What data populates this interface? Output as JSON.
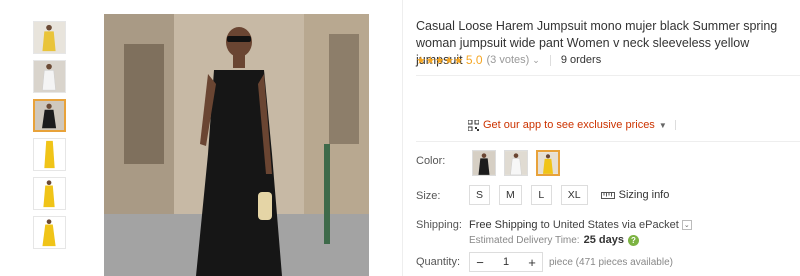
{
  "thumbnails": [
    {
      "name": "thumb-1",
      "color": "#e9c43a"
    },
    {
      "name": "thumb-2",
      "color": "#f1f1f1"
    },
    {
      "name": "thumb-3",
      "color": "#1c1c1c",
      "selected": true
    },
    {
      "name": "thumb-4",
      "color": "#f0c418"
    },
    {
      "name": "thumb-5",
      "color": "#f0c418"
    },
    {
      "name": "thumb-6",
      "color": "#f0c418"
    }
  ],
  "product": {
    "title": "Casual Loose Harem Jumpsuit mono mujer black Summer spring woman jumpsuit wide pant Women v neck sleeveless yellow jumpsuit",
    "stars": "★★★★★",
    "rating": "5.0",
    "votes": "(3 votes)",
    "votes_caret": "⌄",
    "orders": "9 orders"
  },
  "promo": {
    "text": "Get our app to see exclusive prices",
    "caret": "▼"
  },
  "color": {
    "label": "Color:",
    "options": [
      {
        "name": "black",
        "color": "#1c1c1c"
      },
      {
        "name": "white",
        "color": "#f4f4f4"
      },
      {
        "name": "yellow",
        "color": "#f0c418",
        "selected": true
      }
    ]
  },
  "size": {
    "label": "Size:",
    "options": [
      "S",
      "M",
      "L",
      "XL"
    ],
    "info": "Sizing info"
  },
  "shipping": {
    "label": "Shipping:",
    "free": "Free Shipping",
    "to": "to",
    "country": "United States",
    "via": "via ePacket",
    "caret": "⌄",
    "delivery_label": "Estimated Delivery Time:",
    "delivery_days": "25 days",
    "help": "?"
  },
  "quantity": {
    "label": "Quantity:",
    "minus": "−",
    "value": "1",
    "plus": "+",
    "note": "piece (471 pieces available)"
  },
  "colors": {
    "accent": "#e8a23a",
    "star": "#f5a623",
    "promo": "#cc3300",
    "help": "#7cb342"
  }
}
